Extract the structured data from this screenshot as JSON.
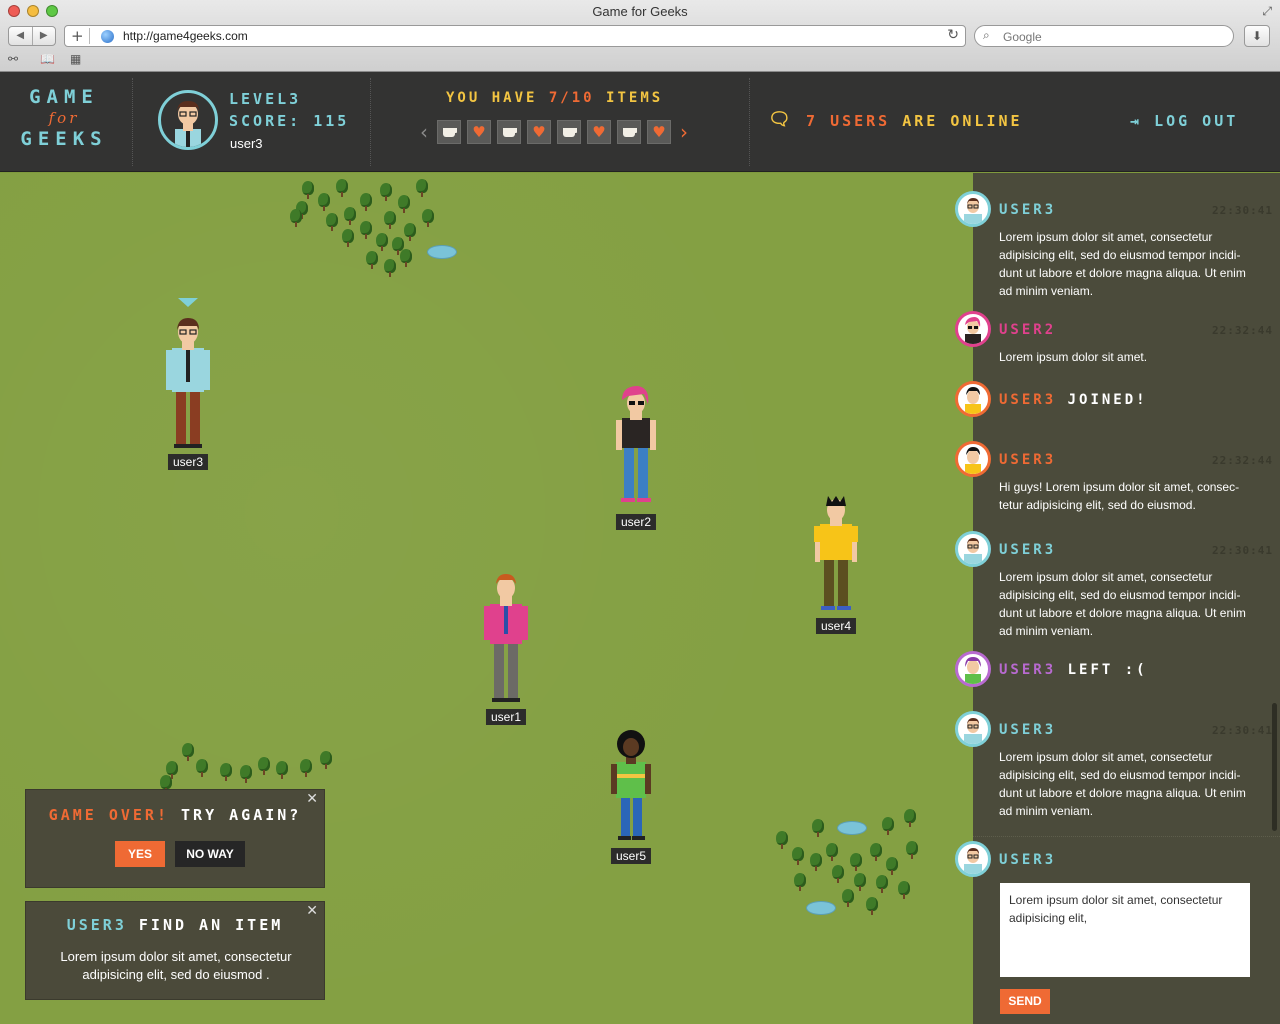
{
  "browser": {
    "window_title": "Game for Geeks",
    "url": "http://game4geeks.com",
    "search_placeholder": "Google"
  },
  "header": {
    "logo": {
      "line1": "GAME",
      "line2": "for",
      "line3": "GEEKS"
    },
    "profile": {
      "level": "LEVEL3",
      "score": "SCORE: 115",
      "username": "user3"
    },
    "items": {
      "prefix": "YOU HAVE",
      "count": "7/10",
      "suffix": "ITEMS",
      "slots": [
        "cup",
        "heart",
        "cup",
        "heart",
        "cup",
        "heart",
        "cup",
        "heart"
      ]
    },
    "online": {
      "count": "7",
      "text_a": "USERS",
      "text_b": "ARE ONLINE"
    },
    "logout": "LOG OUT"
  },
  "map": {
    "players": [
      {
        "name": "user3"
      },
      {
        "name": "user2"
      },
      {
        "name": "user4"
      },
      {
        "name": "user1"
      },
      {
        "name": "user5"
      }
    ]
  },
  "popups": {
    "game_over": {
      "title_a": "GAME OVER!",
      "title_b": "TRY AGAIN?",
      "yes": "YES",
      "no": "NO WAY"
    },
    "find_item": {
      "title_a": "USER3",
      "title_b": "FIND AN ITEM",
      "body": "Lorem ipsum dolor sit amet, consectetur adipisicing elit, sed do eiusmod ."
    }
  },
  "chat": {
    "messages": [
      {
        "user": "USER3",
        "time": "22:30:41",
        "color": "#7fd0d8",
        "text": "Lorem ipsum dolor sit amet, consectetur adipisicing elit, sed do eiusmod tempor incidi-dunt ut labore et dolore magna aliqua. Ut enim ad minim veniam."
      },
      {
        "user": "USER2",
        "time": "22:32:44",
        "color": "#e0418d",
        "text": "Lorem ipsum dolor sit amet."
      },
      {
        "user": "USER3",
        "event": "JOINED!",
        "color": "#ef6a34"
      },
      {
        "user": "USER3",
        "time": "22:32:44",
        "color": "#ef6a34",
        "text": "Hi guys! Lorem ipsum dolor sit amet, consec-tetur adipisicing elit, sed do eiusmod."
      },
      {
        "user": "USER3",
        "time": "22:30:41",
        "color": "#7fd0d8",
        "text": "Lorem ipsum dolor sit amet, consectetur adipisicing elit, sed do eiusmod tempor incidi-dunt ut labore et dolore magna aliqua. Ut enim ad minim veniam."
      },
      {
        "user": "USER3",
        "event": "LEFT :(",
        "color": "#b86ad0"
      },
      {
        "user": "USER3",
        "time": "22:30:41",
        "color": "#7fd0d8",
        "text": "Lorem ipsum dolor sit amet, consectetur adipisicing elit, sed do eiusmod tempor incidi-dunt ut labore et dolore magna aliqua. Ut enim ad minim veniam."
      }
    ],
    "compose": {
      "user": "USER3",
      "value": "Lorem ipsum dolor sit amet, consectetur adipisicing elit,",
      "send": "SEND"
    }
  }
}
